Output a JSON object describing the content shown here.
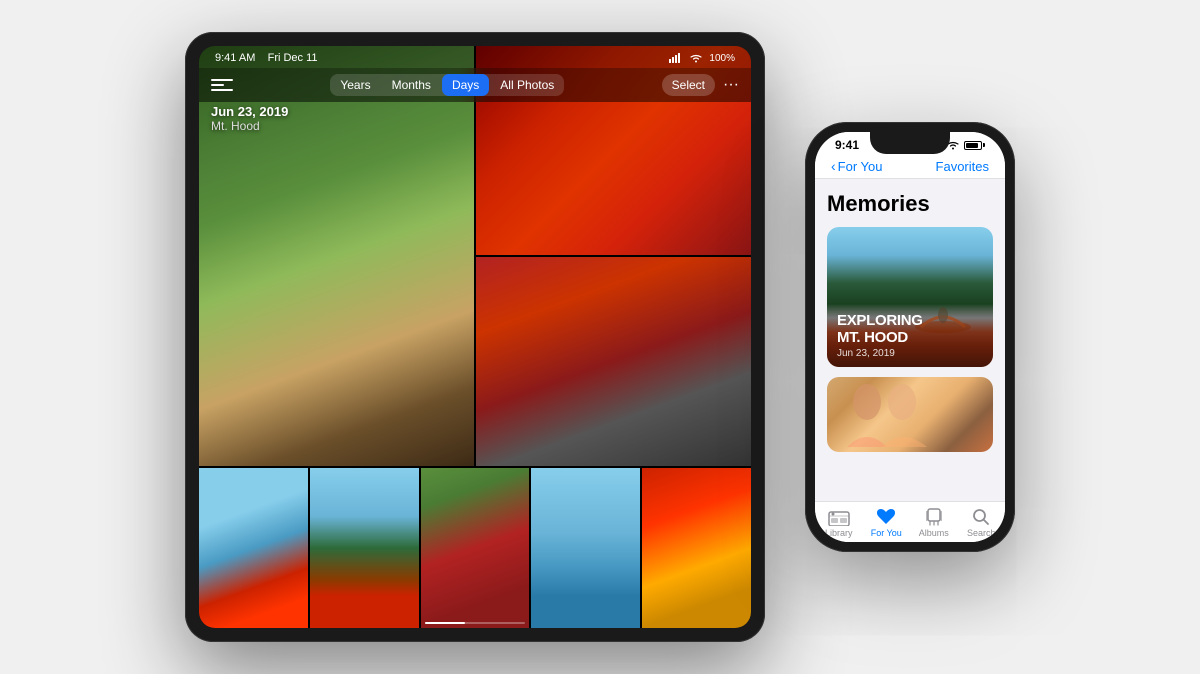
{
  "scene": {
    "background": "#f0f0f0"
  },
  "ipad": {
    "statusbar": {
      "time": "9:41 AM",
      "date": "Fri Dec 11",
      "battery": "100%"
    },
    "navbar": {
      "segments": [
        "Years",
        "Months",
        "Days",
        "All Photos"
      ],
      "active_segment": "Days",
      "select_label": "Select",
      "more_label": "···"
    },
    "date_info": {
      "date": "Jun 23, 2019",
      "location": "Mt. Hood"
    }
  },
  "iphone": {
    "statusbar": {
      "time": "9:41"
    },
    "navbar": {
      "back_label": "For You",
      "favorites_label": "Favorites"
    },
    "content": {
      "section_title": "Memories",
      "memory_1": {
        "title": "EXPLORING\nMT. HOOD",
        "date": "Jun 23, 2019"
      }
    },
    "tabbar": {
      "tabs": [
        {
          "label": "Library",
          "icon": "library-icon",
          "active": false
        },
        {
          "label": "For You",
          "icon": "foryou-icon",
          "active": true
        },
        {
          "label": "Albums",
          "icon": "albums-icon",
          "active": false
        },
        {
          "label": "Search",
          "icon": "search-icon",
          "active": false
        }
      ]
    }
  }
}
